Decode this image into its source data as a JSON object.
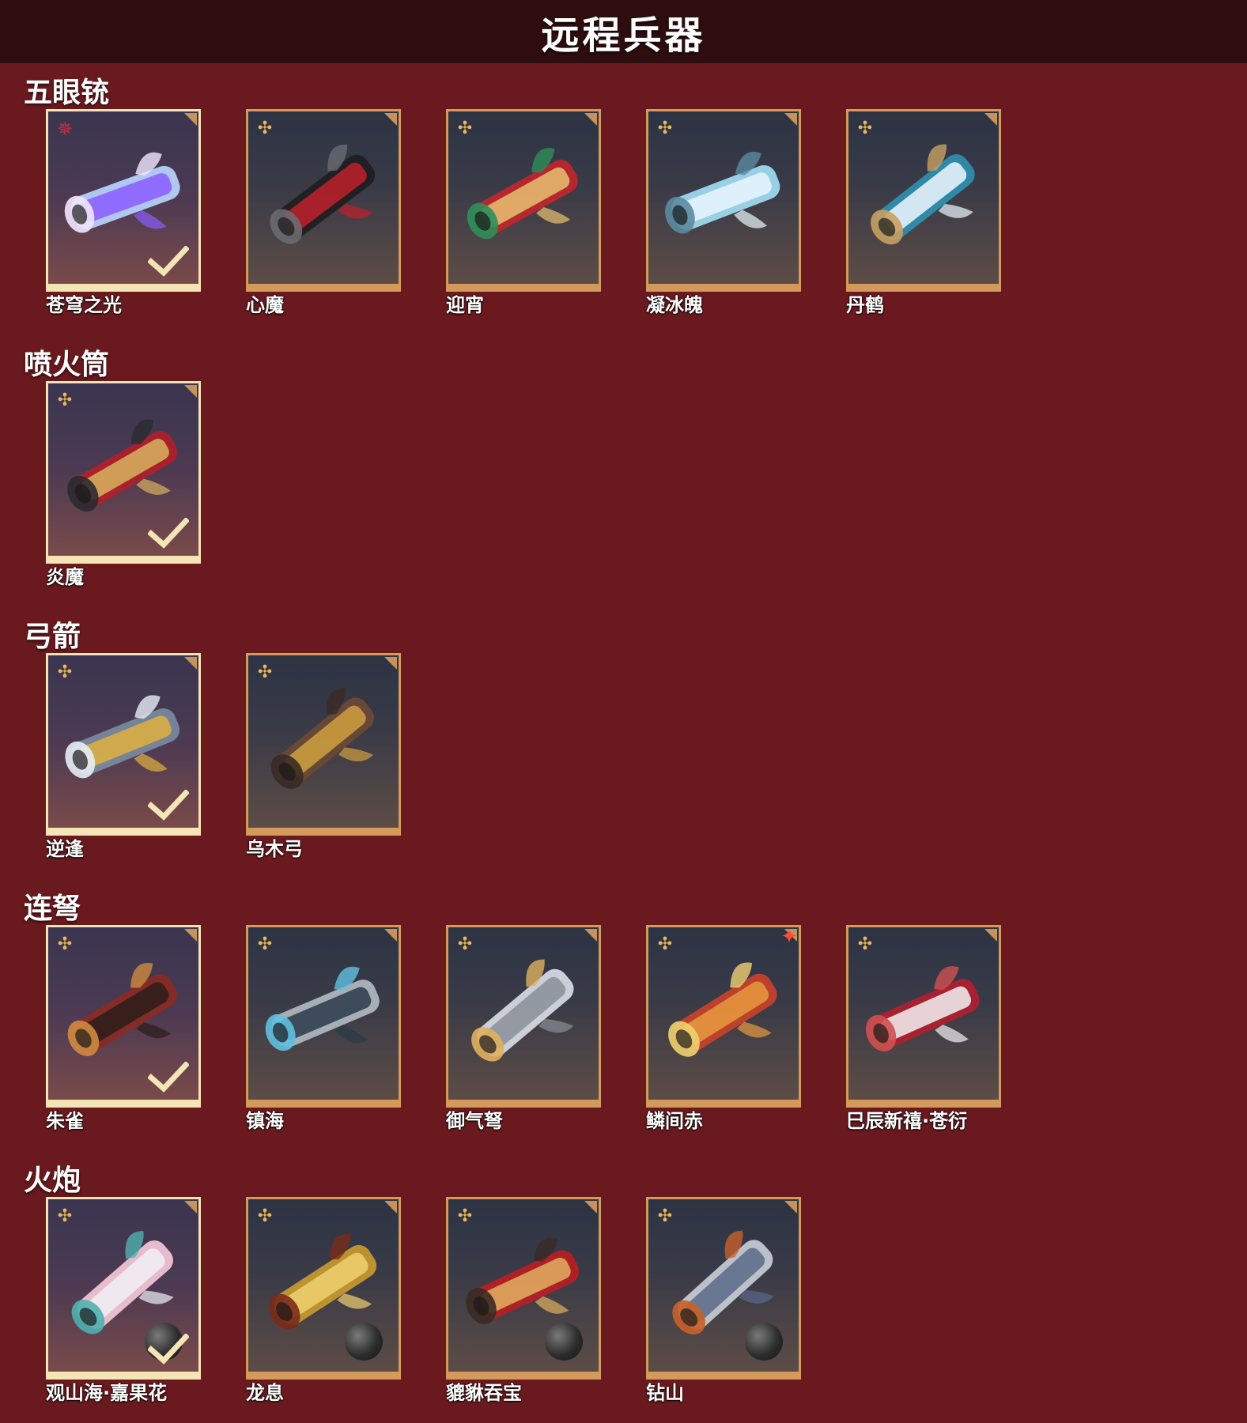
{
  "page": {
    "title": "远程兵器"
  },
  "colors": {
    "background": "#6a1a1f",
    "header": "#2e0d0e",
    "frame": "#d49a5c",
    "frame_selected": "#f5e4b6"
  },
  "sections": [
    {
      "title": "五眼铳",
      "items": [
        {
          "name": "苍穹之光",
          "selected": true,
          "badge": "red-star-icon"
        },
        {
          "name": "心魔",
          "selected": false,
          "badge": "gold-emblem-icon"
        },
        {
          "name": "迎宵",
          "selected": false,
          "badge": "gold-emblem-icon"
        },
        {
          "name": "凝冰魄",
          "selected": false,
          "badge": "gold-emblem-icon"
        },
        {
          "name": "丹鹤",
          "selected": false,
          "badge": "gold-emblem-icon"
        }
      ]
    },
    {
      "title": "喷火筒",
      "items": [
        {
          "name": "炎魔",
          "selected": true,
          "badge": "gold-emblem-icon"
        }
      ]
    },
    {
      "title": "弓箭",
      "items": [
        {
          "name": "逆逢",
          "selected": true,
          "badge": "gold-emblem-icon"
        },
        {
          "name": "乌木弓",
          "selected": false,
          "badge": "gold-emblem-icon"
        }
      ]
    },
    {
      "title": "连弩",
      "items": [
        {
          "name": "朱雀",
          "selected": true,
          "badge": "gold-emblem-icon"
        },
        {
          "name": "镇海",
          "selected": false,
          "badge": "gold-emblem-icon"
        },
        {
          "name": "御气弩",
          "selected": false,
          "badge": "gold-emblem-icon"
        },
        {
          "name": "鳞间赤",
          "selected": false,
          "badge": "gold-emblem-icon",
          "new_mark": "red-spark-icon"
        },
        {
          "name": "巳辰新禧·苍衍",
          "selected": false,
          "badge": "gold-emblem-icon"
        }
      ]
    },
    {
      "title": "火炮",
      "items": [
        {
          "name": "观山海·嘉果花",
          "selected": true,
          "badge": "gold-emblem-icon",
          "ammo": "cannonball-icon"
        },
        {
          "name": "龙息",
          "selected": false,
          "badge": "gold-emblem-icon",
          "ammo": "cannonball-icon"
        },
        {
          "name": "貔貅吞宝",
          "selected": false,
          "badge": "gold-emblem-icon",
          "ammo": "cannonball-icon"
        },
        {
          "name": "钻山",
          "selected": false,
          "badge": "gold-emblem-icon",
          "ammo": "cannonball-icon"
        }
      ]
    }
  ]
}
